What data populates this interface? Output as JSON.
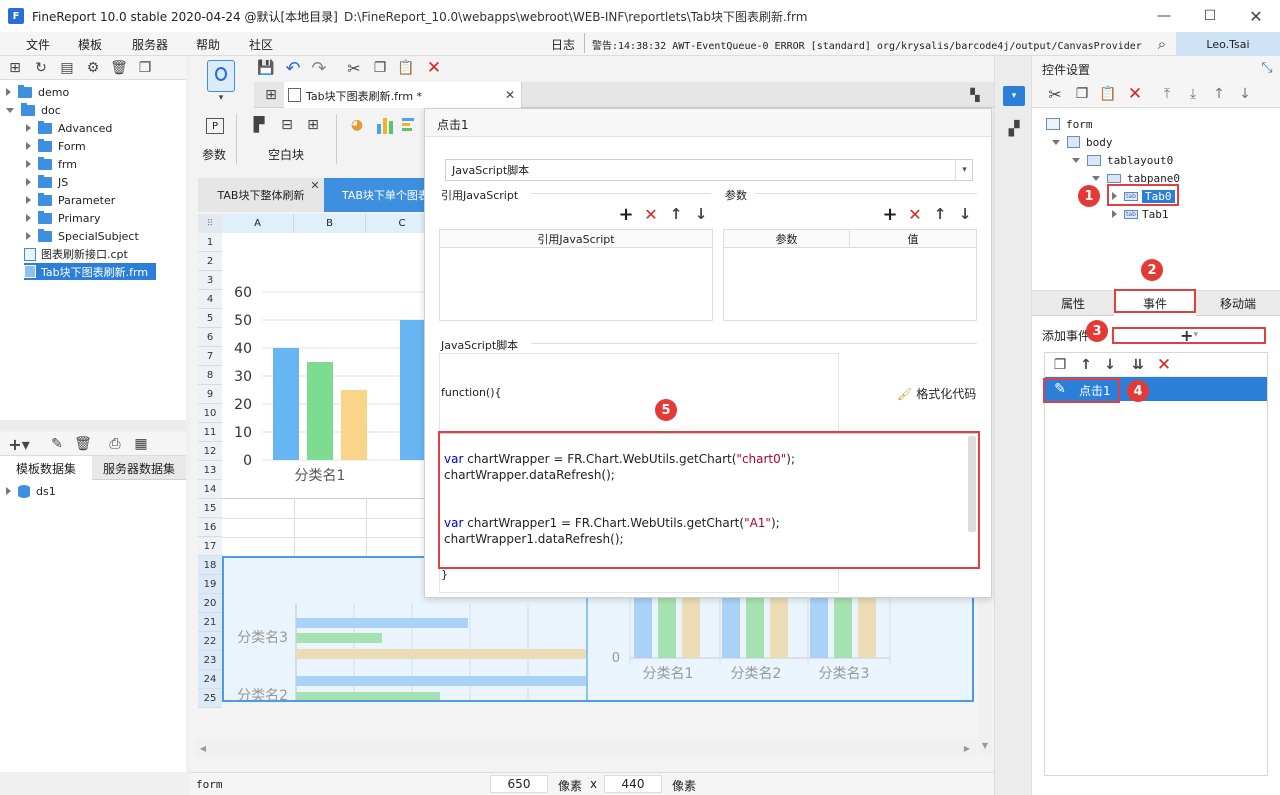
{
  "titlebar": {
    "app": "FineReport 10.0 stable 2020-04-24 @默认[本地目录]",
    "path": "D:\\FineReport_10.0\\webapps\\webroot\\WEB-INF\\reportlets\\Tab块下图表刷新.frm"
  },
  "menu": {
    "items": [
      "文件",
      "模板",
      "服务器",
      "帮助",
      "社区"
    ],
    "log_label": "日志",
    "warning": "警告:14:38:32 AWT-EventQueue-0 ERROR [standard] org/krysalis/barcode4j/output/CanvasProvider",
    "user": "Leo.Tsai"
  },
  "left": {
    "tree": [
      {
        "label": "demo",
        "level": 0,
        "type": "folder",
        "open": false
      },
      {
        "label": "doc",
        "level": 0,
        "type": "folder",
        "open": true
      },
      {
        "label": "Advanced",
        "level": 1,
        "type": "folder"
      },
      {
        "label": "Form",
        "level": 1,
        "type": "folder"
      },
      {
        "label": "frm",
        "level": 1,
        "type": "folder"
      },
      {
        "label": "JS",
        "level": 1,
        "type": "folder"
      },
      {
        "label": "Parameter",
        "level": 1,
        "type": "folder"
      },
      {
        "label": "Primary",
        "level": 1,
        "type": "folder"
      },
      {
        "label": "SpecialSubject",
        "level": 1,
        "type": "folder"
      },
      {
        "label": "图表刷新接口.cpt",
        "level": 0,
        "type": "file"
      },
      {
        "label": "Tab块下图表刷新.frm",
        "level": 0,
        "type": "file",
        "selected": true
      }
    ],
    "dataset_tabs": [
      "模板数据集",
      "服务器数据集"
    ],
    "datasets": [
      "ds1"
    ]
  },
  "center": {
    "file_tab": "Tab块下图表刷新.frm *",
    "param_label": "参数",
    "block_label": "空白块",
    "doc_tabs": [
      "TAB块下整体刷新",
      "TAB块下单个图表"
    ],
    "columns": [
      "A",
      "B",
      "C"
    ],
    "rows": [
      "1",
      "2",
      "3",
      "4",
      "5",
      "6",
      "7",
      "8",
      "9",
      "10",
      "11",
      "12",
      "13",
      "14",
      "15",
      "16",
      "17",
      "18",
      "19",
      "20",
      "21",
      "22",
      "23",
      "24",
      "25"
    ],
    "status": {
      "name": "form",
      "width": "650",
      "unit": "像素",
      "x": "x",
      "height": "440"
    }
  },
  "chart_data": [
    {
      "type": "bar",
      "categories": [
        "分类名1"
      ],
      "yticks": [
        "60",
        "50",
        "40",
        "30",
        "20",
        "10",
        "0"
      ],
      "ylim": [
        0,
        60
      ],
      "series": [
        {
          "values": [
            40
          ],
          "color": "#67b6f3"
        },
        {
          "values": [
            35
          ],
          "color": "#7ddc8f"
        },
        {
          "values": [
            25
          ],
          "color": "#f9d58a"
        }
      ]
    },
    {
      "type": "bar",
      "categories": [
        "分类名3",
        "分类名2"
      ],
      "orientation": "horizontal"
    },
    {
      "type": "bar",
      "categories": [
        "分类名1",
        "分类名2",
        "分类名3"
      ],
      "yticks": [
        "0"
      ]
    }
  ],
  "dialog": {
    "title": "点击1",
    "script_type": "JavaScript脚本",
    "ref_js_label": "引用JavaScript",
    "ref_js_header": "引用JavaScript",
    "param_label": "参数",
    "param_headers": [
      "参数",
      "值"
    ],
    "script_label": "JavaScript脚本",
    "func_open": "function(){",
    "func_close": "}",
    "format_label": "格式化代码",
    "code_lines": [
      {
        "kw": "var",
        "rest": " chartWrapper = FR.Chart.WebUtils.getChart(",
        "str": "\"chart0\"",
        "end": ");"
      },
      {
        "kw": "",
        "rest": "chartWrapper.dataRefresh();",
        "str": "",
        "end": ""
      },
      {
        "kw": "",
        "rest": "",
        "str": "",
        "end": ""
      },
      {
        "kw": "",
        "rest": "",
        "str": "",
        "end": ""
      },
      {
        "kw": "var",
        "rest": " chartWrapper1 = FR.Chart.WebUtils.getChart(",
        "str": "\"A1\"",
        "end": ");"
      },
      {
        "kw": "",
        "rest": "chartWrapper1.dataRefresh();",
        "str": "",
        "end": ""
      }
    ]
  },
  "right": {
    "title": "控件设置",
    "tree": [
      {
        "label": "form",
        "level": 0,
        "open": true
      },
      {
        "label": "body",
        "level": 1,
        "open": true
      },
      {
        "label": "tablayout0",
        "level": 2,
        "open": true
      },
      {
        "label": "tabpane0",
        "level": 3,
        "open": true
      },
      {
        "label": "Tab0",
        "level": 4,
        "selected": true
      },
      {
        "label": "Tab1",
        "level": 4
      }
    ],
    "tabs": [
      "属性",
      "事件",
      "移动端"
    ],
    "add_event": "添加事件",
    "event_item": "点击1",
    "badges": [
      "1",
      "2",
      "3",
      "4",
      "5"
    ]
  }
}
